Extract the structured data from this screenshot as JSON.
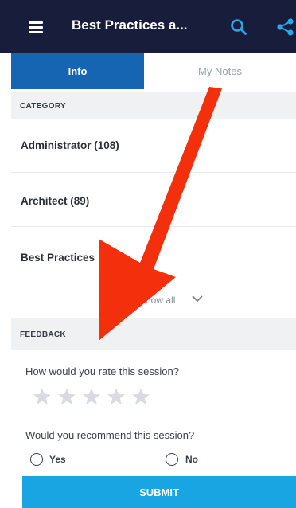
{
  "header": {
    "title": "Best Practices a...",
    "menu_icon": "hamburger-menu-icon",
    "search_icon": "search-icon",
    "share_icon": "share-icon",
    "background": "#171d3a"
  },
  "tabs": [
    {
      "label": "Info",
      "active": true
    },
    {
      "label": "My Notes",
      "active": false
    }
  ],
  "category": {
    "header": "CATEGORY",
    "items": [
      {
        "label": "Administrator (108)"
      },
      {
        "label": "Architect (89)"
      },
      {
        "label": "Best Practices"
      }
    ],
    "show_all": "Show all"
  },
  "feedback": {
    "header": "FEEDBACK",
    "rating_question": "How would you rate this session?",
    "rating_value": 0,
    "rating_max": 5,
    "recommend_question": "Would you recommend this session?",
    "options": [
      "Yes",
      "No"
    ],
    "submit_label": "SUBMIT"
  },
  "colors": {
    "accent": "#1565b3",
    "submit": "#19a4e2",
    "annotation_arrow": "#f4300c"
  }
}
